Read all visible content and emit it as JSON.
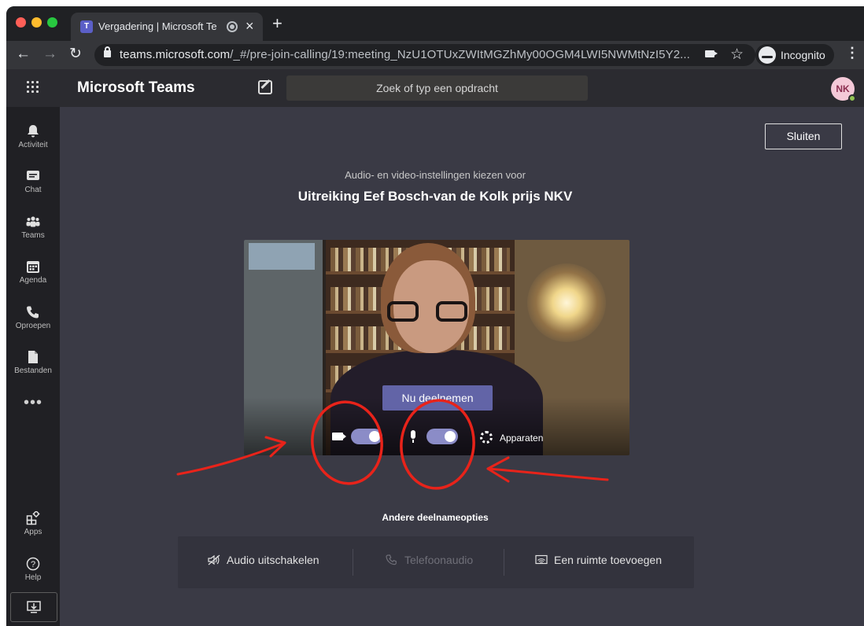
{
  "browser": {
    "tab_title": "Vergadering | Microsoft Te",
    "tab_favicon": "T",
    "new_tab": "+",
    "tab_close": "×",
    "url_host": "teams.microsoft.com",
    "url_path": "/_#/pre-join-calling/19:meeting_NzU1OTUxZWItMGZhMy00OGM4LWI5NWMtNzI5Y2...",
    "incognito_label": "Incognito",
    "menu": "⋮",
    "back": "←",
    "forward": "→",
    "reload": "↻",
    "star": "☆"
  },
  "teams": {
    "app_name": "Microsoft Teams",
    "search_placeholder": "Zoek of typ een opdracht",
    "avatar_initials": "NK"
  },
  "rail": {
    "items": [
      {
        "label": "Activiteit",
        "icon": "bell-icon"
      },
      {
        "label": "Chat",
        "icon": "chat-icon"
      },
      {
        "label": "Teams",
        "icon": "teams-icon"
      },
      {
        "label": "Agenda",
        "icon": "calendar-icon"
      },
      {
        "label": "Oproepen",
        "icon": "phone-icon"
      },
      {
        "label": "Bestanden",
        "icon": "files-icon"
      }
    ],
    "more": "•••",
    "apps_label": "Apps",
    "help_label": "Help"
  },
  "prejoin": {
    "close_label": "Sluiten",
    "subtitle": "Audio- en video-instellingen kiezen voor",
    "meeting_title": "Uitreiking Eef Bosch-van de Kolk prijs NKV",
    "join_label": "Nu deelnemen",
    "camera_on": true,
    "mic_on": true,
    "devices_label": "Apparaten",
    "other_options_title": "Andere deelnameopties",
    "options": {
      "audio_off": "Audio uitschakelen",
      "phone_audio": "Telefoonaudio",
      "add_room": "Een ruimte toevoegen"
    }
  },
  "colors": {
    "accent": "#6264a7",
    "toggle": "#8b8cc7",
    "annotation": "#e8231a"
  }
}
